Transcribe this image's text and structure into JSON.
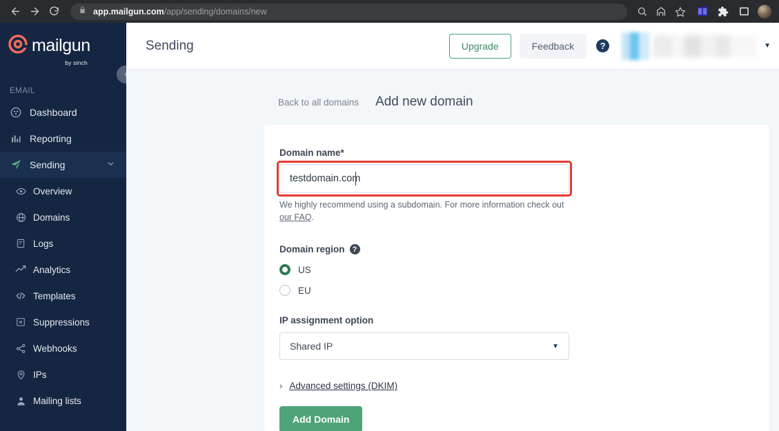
{
  "browser": {
    "url_domain": "app.mailgun.com",
    "url_path": "/app/sending/domains/new",
    "back_icon": "back-arrow-icon",
    "forward_icon": "forward-arrow-icon",
    "reload_icon": "reload-icon",
    "lock_icon": "lock-icon",
    "search_icon": "search-icon",
    "share_icon": "share-icon",
    "bookmark_icon": "star-icon",
    "extension_icon": "puzzle-icon",
    "sidepanel_icon": "side-panel-icon",
    "profile_icon": "profile-avatar"
  },
  "sidebar": {
    "logo_text": "mailgun",
    "logo_sub": "by sinch",
    "section_label": "EMAIL",
    "collapse_label": "‹",
    "items": [
      {
        "label": "Dashboard",
        "icon": "dashboard-icon"
      },
      {
        "label": "Reporting",
        "icon": "bar-chart-icon"
      },
      {
        "label": "Sending",
        "icon": "paper-plane-icon"
      },
      {
        "label": "Overview",
        "icon": "eye-icon"
      },
      {
        "label": "Domains",
        "icon": "globe-icon"
      },
      {
        "label": "Logs",
        "icon": "document-icon"
      },
      {
        "label": "Analytics",
        "icon": "line-chart-icon"
      },
      {
        "label": "Templates",
        "icon": "code-icon"
      },
      {
        "label": "Suppressions",
        "icon": "box-x-icon"
      },
      {
        "label": "Webhooks",
        "icon": "share-nodes-icon"
      },
      {
        "label": "IPs",
        "icon": "location-pin-icon"
      },
      {
        "label": "Mailing lists",
        "icon": "person-icon"
      }
    ]
  },
  "topbar": {
    "title": "Sending",
    "upgrade_label": "Upgrade",
    "feedback_label": "Feedback",
    "help_label": "?",
    "user_caret": "▼"
  },
  "breadcrumb": {
    "back_label": "Back to all domains",
    "page_title": "Add new domain"
  },
  "form": {
    "domain_label": "Domain name*",
    "domain_value": "testdomain.com",
    "domain_placeholder": "",
    "help_text_1": "We highly recommend using a subdomain. For more information check out ",
    "help_link": "our FAQ",
    "help_text_2": ".",
    "region_label": "Domain region",
    "region_help": "?",
    "region_options": [
      {
        "label": "US",
        "selected": true
      },
      {
        "label": "EU",
        "selected": false
      }
    ],
    "ip_label": "IP assignment option",
    "ip_value": "Shared IP",
    "ip_arrow": "▼",
    "advanced_chevron": "›",
    "advanced_label": "Advanced settings (DKIM)",
    "submit_label": "Add Domain"
  },
  "colors": {
    "sidebar_bg": "#152642",
    "accent_green": "#4ea378",
    "upgrade_border": "#4e9e78",
    "highlight_red": "#e03b2f",
    "page_bg": "#f4f7fa"
  }
}
